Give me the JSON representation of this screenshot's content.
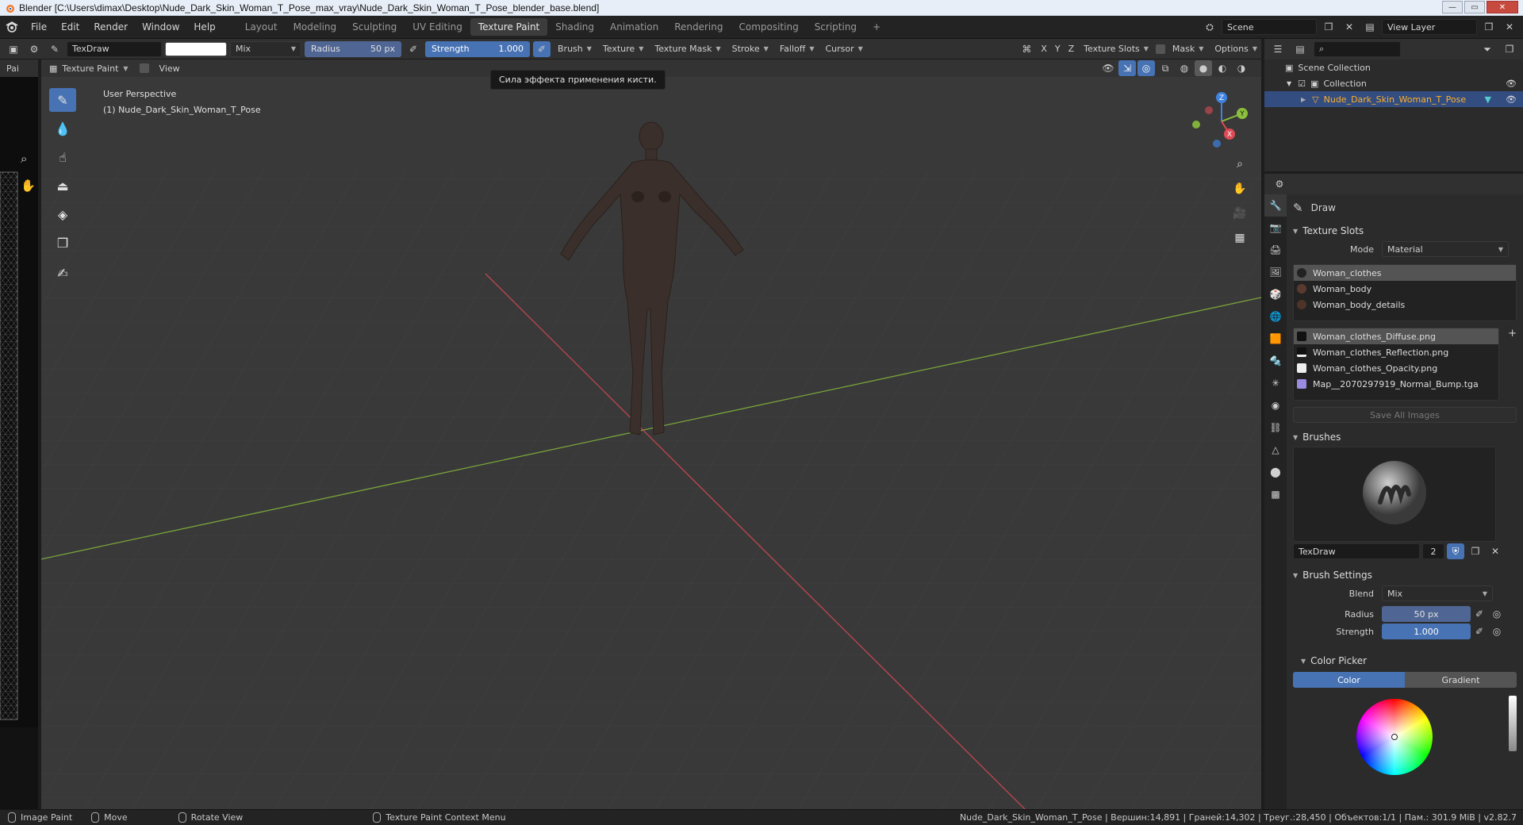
{
  "titlebar": {
    "title": "Blender [C:\\Users\\dimax\\Desktop\\Nude_Dark_Skin_Woman_T_Pose_max_vray\\Nude_Dark_Skin_Woman_T_Pose_blender_base.blend]",
    "minimize": "—",
    "maximize": "▭",
    "close": "✕"
  },
  "menu": {
    "items": [
      "File",
      "Edit",
      "Render",
      "Window",
      "Help"
    ],
    "workspaces": [
      "Layout",
      "Modeling",
      "Sculpting",
      "UV Editing",
      "Texture Paint",
      "Shading",
      "Animation",
      "Rendering",
      "Compositing",
      "Scripting"
    ],
    "active_workspace": "Texture Paint",
    "add_tab": "+",
    "scene": "Scene",
    "view_layer": "View Layer"
  },
  "toolheader": {
    "brush_name": "TexDraw",
    "blend": "Mix",
    "radius_label": "Radius",
    "radius_value": "50 px",
    "strength_label": "Strength",
    "strength_value": "1.000",
    "menus": [
      "Brush",
      "Texture",
      "Texture Mask",
      "Stroke",
      "Falloff",
      "Cursor"
    ],
    "axes": [
      "X",
      "Y",
      "Z"
    ],
    "texture_slots": "Texture Slots",
    "mask": "Mask",
    "options": "Options"
  },
  "leftstrip": {
    "label": "Pai"
  },
  "viewport": {
    "mode": "Texture Paint",
    "view_menu": "View",
    "perspective": "User Perspective",
    "object_label": "(1) Nude_Dark_Skin_Woman_T_Pose",
    "tooltip": "Сила эффекта применения кисти.",
    "gizmo": {
      "x": "X",
      "y": "Y",
      "z": "Z"
    },
    "colors": {
      "x_axis": "#e04a55",
      "y_axis": "#8bbf3c",
      "z_axis": "#3f82e0",
      "grid_bg": "#393939"
    }
  },
  "outliner": {
    "scene_collection": "Scene Collection",
    "collection": "Collection",
    "object": "Nude_Dark_Skin_Woman_T_Pose"
  },
  "properties": {
    "tool_name": "Draw",
    "texture_slots": {
      "title": "Texture Slots",
      "mode_label": "Mode",
      "mode_value": "Material",
      "materials": [
        "Woman_clothes",
        "Woman_body",
        "Woman_body_details"
      ],
      "images": [
        "Woman_clothes_Diffuse.png",
        "Woman_clothes_Reflection.png",
        "Woman_clothes_Opacity.png",
        "Map__2070297919_Normal_Bump.tga"
      ],
      "save_all": "Save All Images"
    },
    "brushes": {
      "title": "Brushes",
      "brush_name": "TexDraw",
      "users": "2"
    },
    "brush_settings": {
      "title": "Brush Settings",
      "blend_label": "Blend",
      "blend_value": "Mix",
      "radius_label": "Radius",
      "radius_value": "50 px",
      "strength_label": "Strength",
      "strength_value": "1.000"
    },
    "color_picker": {
      "title": "Color Picker",
      "color_tab": "Color",
      "gradient_tab": "Gradient"
    }
  },
  "statusbar": {
    "items": [
      "Image Paint",
      "Move",
      "Rotate View",
      "Texture Paint Context Menu"
    ],
    "stats": "Nude_Dark_Skin_Woman_T_Pose | Вершин:14,891 | Граней:14,302 | Треуг.:28,450 | Объектов:1/1 | Пам.: 301.9 MiB | v2.82.7"
  }
}
